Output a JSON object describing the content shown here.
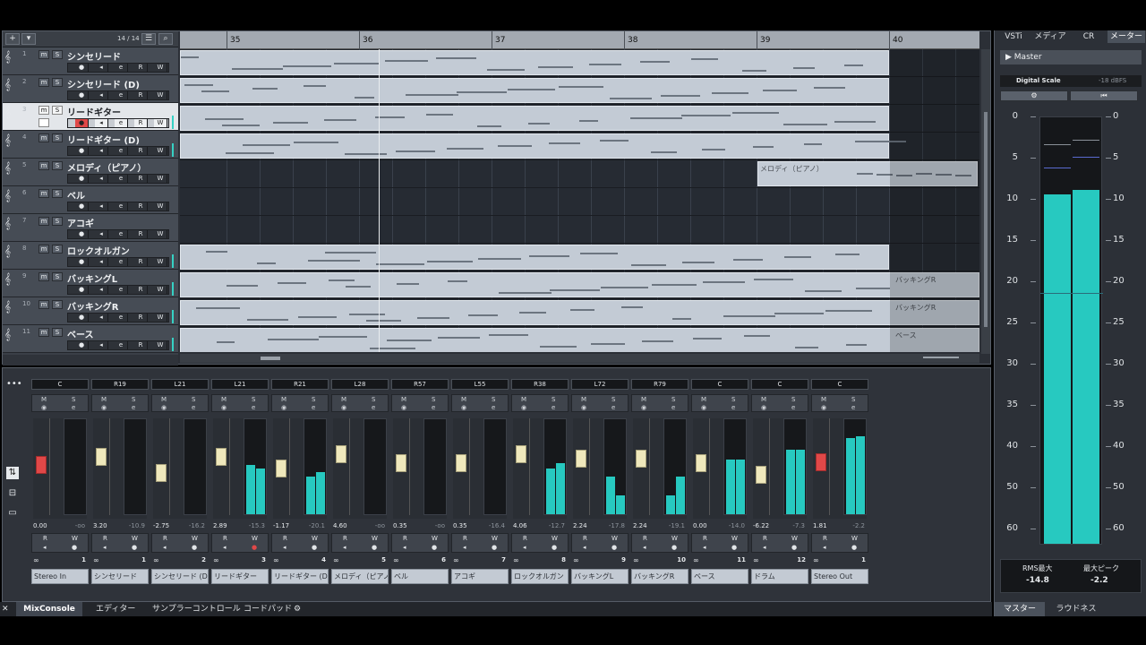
{
  "project": {
    "track_count": "14 / 14",
    "ruler": [
      "35",
      "36",
      "37",
      "38",
      "39",
      "40"
    ],
    "tracks": [
      {
        "num": "1",
        "name": "シンセリード",
        "selected": false,
        "level": false
      },
      {
        "num": "2",
        "name": "シンセリード (D)",
        "selected": false,
        "level": false
      },
      {
        "num": "3",
        "name": "リードギター",
        "selected": true,
        "level": true
      },
      {
        "num": "4",
        "name": "リードギター (D)",
        "selected": false,
        "level": true
      },
      {
        "num": "5",
        "name": "メロディ（ピアノ）",
        "selected": false,
        "level": false
      },
      {
        "num": "6",
        "name": "ベル",
        "selected": false,
        "level": false
      },
      {
        "num": "7",
        "name": "アコギ",
        "selected": false,
        "level": false
      },
      {
        "num": "8",
        "name": "ロックオルガン",
        "selected": false,
        "level": true
      },
      {
        "num": "9",
        "name": "バッキングL",
        "selected": false,
        "level": true
      },
      {
        "num": "10",
        "name": "バッキングR",
        "selected": false,
        "level": true
      },
      {
        "num": "11",
        "name": "ベース",
        "selected": false,
        "level": true
      }
    ],
    "track_buttons": {
      "m": "m",
      "s": "S",
      "e": "e",
      "r": "R",
      "w": "W"
    },
    "clip_labels": {
      "melody": "メロディ（ピアノ）",
      "backing_l": "バッキングR",
      "backing_r": "バッキングR",
      "bass": "ベース"
    }
  },
  "mixer": {
    "channels": [
      {
        "pan": "C",
        "vol": "0.00",
        "peak": "-oo",
        "name": "Stereo In",
        "io": "1",
        "fader": 0.52,
        "red": true,
        "m1": 0,
        "m2": 0
      },
      {
        "pan": "R19",
        "vol": "3.20",
        "peak": "-10.9",
        "name": "シンセリード",
        "io": "1",
        "fader": 0.62,
        "red": false,
        "m1": 0,
        "m2": 0
      },
      {
        "pan": "L21",
        "vol": "-2.75",
        "peak": "-16.2",
        "name": "シンセリード (D)",
        "io": "2",
        "fader": 0.42,
        "red": false,
        "m1": 0,
        "m2": 0
      },
      {
        "pan": "L21",
        "vol": "2.89",
        "peak": "-15.3",
        "name": "リードギター",
        "io": "3",
        "fader": 0.62,
        "red": false,
        "m1": 0.52,
        "m2": 0.48
      },
      {
        "pan": "R21",
        "vol": "-1.17",
        "peak": "-20.1",
        "name": "リードギター (D)",
        "io": "4",
        "fader": 0.48,
        "red": false,
        "m1": 0.4,
        "m2": 0.44
      },
      {
        "pan": "L28",
        "vol": "4.60",
        "peak": "-oo",
        "name": "メロディ（ピアノ）",
        "io": "5",
        "fader": 0.66,
        "red": false,
        "m1": 0,
        "m2": 0
      },
      {
        "pan": "R57",
        "vol": "0.35",
        "peak": "-oo",
        "name": "ベル",
        "io": "6",
        "fader": 0.54,
        "red": false,
        "m1": 0,
        "m2": 0
      },
      {
        "pan": "L55",
        "vol": "0.35",
        "peak": "-16.4",
        "name": "アコギ",
        "io": "7",
        "fader": 0.54,
        "red": false,
        "m1": 0,
        "m2": 0
      },
      {
        "pan": "R38",
        "vol": "4.06",
        "peak": "-12.7",
        "name": "ロックオルガン",
        "io": "8",
        "fader": 0.66,
        "red": false,
        "m1": 0.48,
        "m2": 0.54
      },
      {
        "pan": "L72",
        "vol": "2.24",
        "peak": "-17.8",
        "name": "バッキングL",
        "io": "9",
        "fader": 0.6,
        "red": false,
        "m1": 0.4,
        "m2": 0.2
      },
      {
        "pan": "R79",
        "vol": "2.24",
        "peak": "-19.1",
        "name": "バッキングR",
        "io": "10",
        "fader": 0.6,
        "red": false,
        "m1": 0.2,
        "m2": 0.4
      },
      {
        "pan": "C",
        "vol": "0.00",
        "peak": "-14.0",
        "name": "ベース",
        "io": "11",
        "fader": 0.54,
        "red": false,
        "m1": 0.58,
        "m2": 0.58
      },
      {
        "pan": "C",
        "vol": "-6.22",
        "peak": "-7.3",
        "name": "ドラム",
        "io": "12",
        "fader": 0.4,
        "red": false,
        "m1": 0.68,
        "m2": 0.68
      },
      {
        "pan": "C",
        "vol": "1.81",
        "peak": "-2.2",
        "name": "Stereo Out",
        "io": "1",
        "fader": 0.56,
        "red": true,
        "m1": 0.8,
        "m2": 0.82
      }
    ],
    "ms_labels": {
      "m": "M",
      "s": "S",
      "r": "R",
      "w": "W"
    }
  },
  "bottom_tabs": [
    "MixConsole",
    "エディター",
    "サンプラーコントロール",
    "コードパッド"
  ],
  "right": {
    "tabs": [
      "VSTi",
      "メディア",
      "CR",
      "メーター"
    ],
    "master": "Master",
    "digital_scale": "Digital Scale",
    "dbfs": "-18 dBFS",
    "scale": [
      "0",
      "5",
      "10",
      "15",
      "20",
      "25",
      "30",
      "35",
      "40",
      "50",
      "60"
    ],
    "meter_l": 0.82,
    "meter_r": 0.83,
    "rms_label": "RMS最大",
    "rms_value": "-14.8",
    "peak_label": "最大ピーク",
    "peak_value": "-2.2",
    "bottom_tabs": [
      "マスター",
      "ラウドネス"
    ]
  },
  "colors": {
    "accent": "#27c9c0",
    "record": "#e04848",
    "fader": "#efe8bc"
  }
}
